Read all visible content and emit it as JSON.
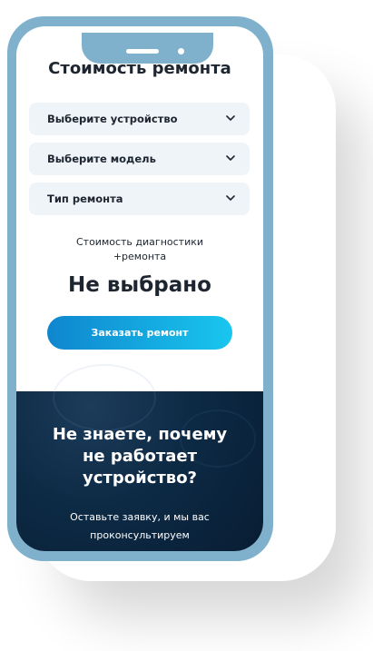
{
  "colors": {
    "frame": "#7fb1cd",
    "accent_start": "#0f86cf",
    "accent_end": "#19c6ee",
    "dark_bg": "#0d2a45",
    "select_bg": "#eef4f8",
    "text": "#1d2530"
  },
  "calculator": {
    "title": "Стоимость ремонта",
    "selects": [
      {
        "label": "Выберите устройство",
        "icon": "chevron-down-icon"
      },
      {
        "label": "Выберите модель",
        "icon": "chevron-down-icon"
      },
      {
        "label": "Тип ремонта",
        "icon": "chevron-down-icon"
      }
    ],
    "cost_label_line1": "Стоимость диагностики",
    "cost_label_line2": "+ремонта",
    "cost_value": "Не выбрано",
    "order_button": "Заказать ремонт"
  },
  "consult": {
    "title_line1": "Не знаете, почему",
    "title_line2": "не работает",
    "title_line3": "устройство?",
    "subtitle_line1": "Оставьте заявку, и мы вас",
    "subtitle_line2": "проконсультируем"
  }
}
